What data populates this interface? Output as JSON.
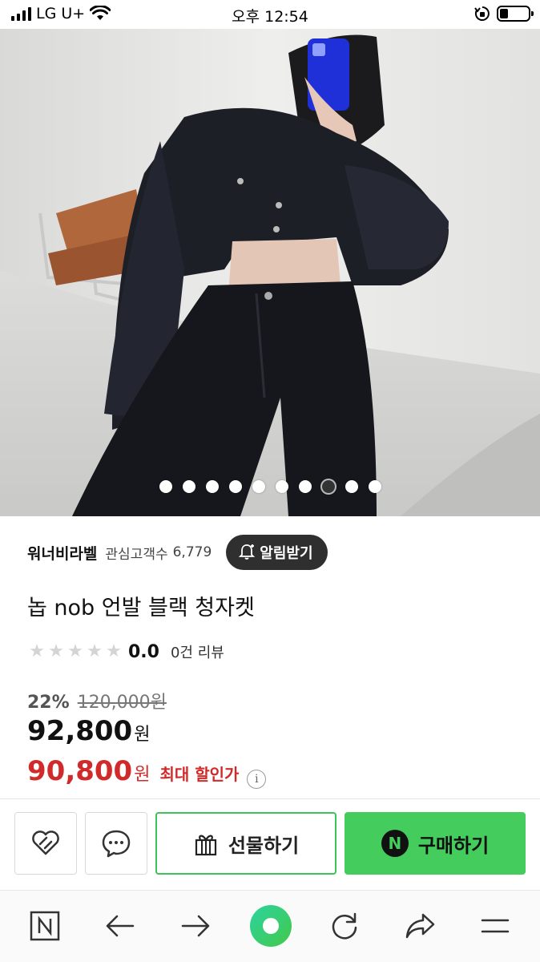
{
  "status_bar": {
    "carrier": "LG U+",
    "time": "오후 12:54",
    "battery_level": 0.3
  },
  "gallery": {
    "image_count": 10,
    "active_index": 7
  },
  "store": {
    "name": "워너비라벨",
    "followers_label": "관심고객수",
    "followers_count": "6,779",
    "notify_label": "알림받기"
  },
  "product": {
    "title": "놉 nob 언발 블랙 청자켓",
    "rating": "0.0",
    "rating_stars": 0,
    "review_count": "0건 리뷰",
    "discount_rate": "22%",
    "original_price": "120,000원",
    "price": "92,800",
    "price_unit": "원",
    "max_discount_price": "90,800",
    "max_discount_unit": "원",
    "max_discount_label": "최대 할인가",
    "info_symbol": "i"
  },
  "actions": {
    "wishlist_icon": "heart-icon",
    "talk_icon": "chat-bubble-icon",
    "gift_label": "선물하기",
    "buy_label": "구매하기",
    "buy_badge": "N",
    "buy_color": "#44cd5c",
    "gift_border_color": "#3cc45b",
    "max_price_color": "#d12a2a"
  },
  "toolbar": {
    "home_badge": "N",
    "items": [
      "naver-home-icon",
      "back-arrow-icon",
      "forward-arrow-icon",
      "green-dot-icon",
      "refresh-icon",
      "share-icon",
      "menu-icon"
    ]
  }
}
